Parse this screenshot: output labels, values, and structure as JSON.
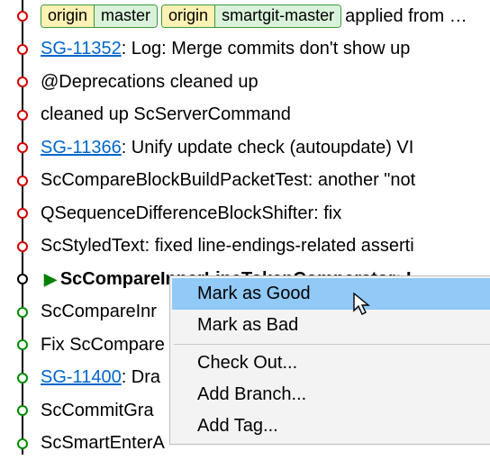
{
  "refs": [
    {
      "remote": "origin",
      "branch": "master"
    },
    {
      "remote": "origin",
      "branch": "smartgit-master"
    }
  ],
  "commits": [
    {
      "node": "red",
      "link": "",
      "msg1": "applied from …",
      "hasRefs": true
    },
    {
      "node": "red",
      "link": "SG-11352",
      "msg1": ": Log: Merge commits don't show up"
    },
    {
      "node": "red",
      "link": "",
      "msg1": "@Deprecations cleaned up"
    },
    {
      "node": "red",
      "link": "",
      "msg1": "cleaned up ScServerCommand"
    },
    {
      "node": "red",
      "link": "SG-11366",
      "msg1": ": Unify update check (autoupdate) VI"
    },
    {
      "node": "red",
      "link": "",
      "msg1": "ScCompareBlockBuildPacketTest: another \"not "
    },
    {
      "node": "red",
      "link": "",
      "msg1": "QSequenceDifferenceBlockShifter: fix"
    },
    {
      "node": "red",
      "link": "",
      "msg1": "ScStyledText: fixed line-endings-related asserti"
    },
    {
      "node": "black",
      "link": "",
      "msg1": "ScCompareInnerLineTokenComparator: I",
      "selected": true
    },
    {
      "node": "green",
      "link": "",
      "msg1": "ScCompareInr"
    },
    {
      "node": "green",
      "link": "",
      "msg1": "Fix ScCompare"
    },
    {
      "node": "green",
      "link": "SG-11400",
      "msg1": ": Dra"
    },
    {
      "node": "green",
      "link": "",
      "msg1": "ScCommitGra"
    },
    {
      "node": "green",
      "link": "",
      "msg1": "ScSmartEnterA"
    }
  ],
  "menu": {
    "items": [
      {
        "label": "Mark as Good",
        "highlight": true
      },
      {
        "label": "Mark as Bad"
      },
      {
        "sep": true
      },
      {
        "label": "Check Out..."
      },
      {
        "label": "Add Branch..."
      },
      {
        "label": "Add Tag..."
      }
    ]
  }
}
